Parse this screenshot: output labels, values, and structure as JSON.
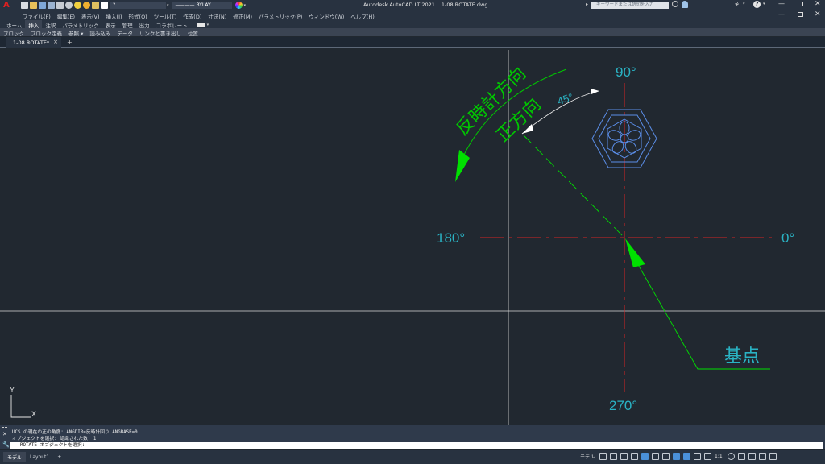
{
  "title": {
    "app": "Autodesk AutoCAD LT 2021",
    "file": "1-08 ROTATE.dwg",
    "layer_value": "?",
    "linetype_value": "BYLAY...",
    "search_placeholder": "キーワードまたは語句を入力"
  },
  "menu": [
    "ファイル(F)",
    "編集(E)",
    "表示(V)",
    "挿入(I)",
    "形式(O)",
    "ツール(T)",
    "作成(D)",
    "寸法(N)",
    "修正(M)",
    "パラメトリック(P)",
    "ウィンドウ(W)",
    "ヘルプ(H)"
  ],
  "ribbon_tabs": [
    "ホーム",
    "挿入",
    "注釈",
    "パラメトリック",
    "表示",
    "管理",
    "出力",
    "コラボレート"
  ],
  "ribbon_panels": [
    "ブロック",
    "ブロック定義",
    "参照 ▾",
    "読み込み",
    "データ",
    "リンクと書き出し",
    "位置"
  ],
  "doc_tab": {
    "name": "1-08 ROTATE*",
    "close": "×",
    "add": "+"
  },
  "drawing": {
    "angle_90": "90°",
    "angle_0": "0°",
    "angle_180": "180°",
    "angle_270": "270°",
    "angle_45": "45°",
    "ccw_label": "反時計方向",
    "positive_label": "正方向",
    "base_point_label": "基点",
    "ucs_x": "X",
    "ucs_y": "Y",
    "colors": {
      "red_axis": "#d42525",
      "cyan_text": "#2ab3c4",
      "green": "#00e000",
      "block_blue": "#5b8ee8",
      "crosshair": "#e8e8e8"
    }
  },
  "command": {
    "line1": "UCS の現在の正の角度:  ANGDIR=反時計回り  ANGBASE=0",
    "line2": "オブジェクトを選択: 認識された数: 1",
    "prompt": "- ROTATE オブジェクトを選択:"
  },
  "status": {
    "tabs": [
      "モデル",
      "Layout1"
    ],
    "add": "+",
    "model": "モデル",
    "scale": "1:1"
  }
}
